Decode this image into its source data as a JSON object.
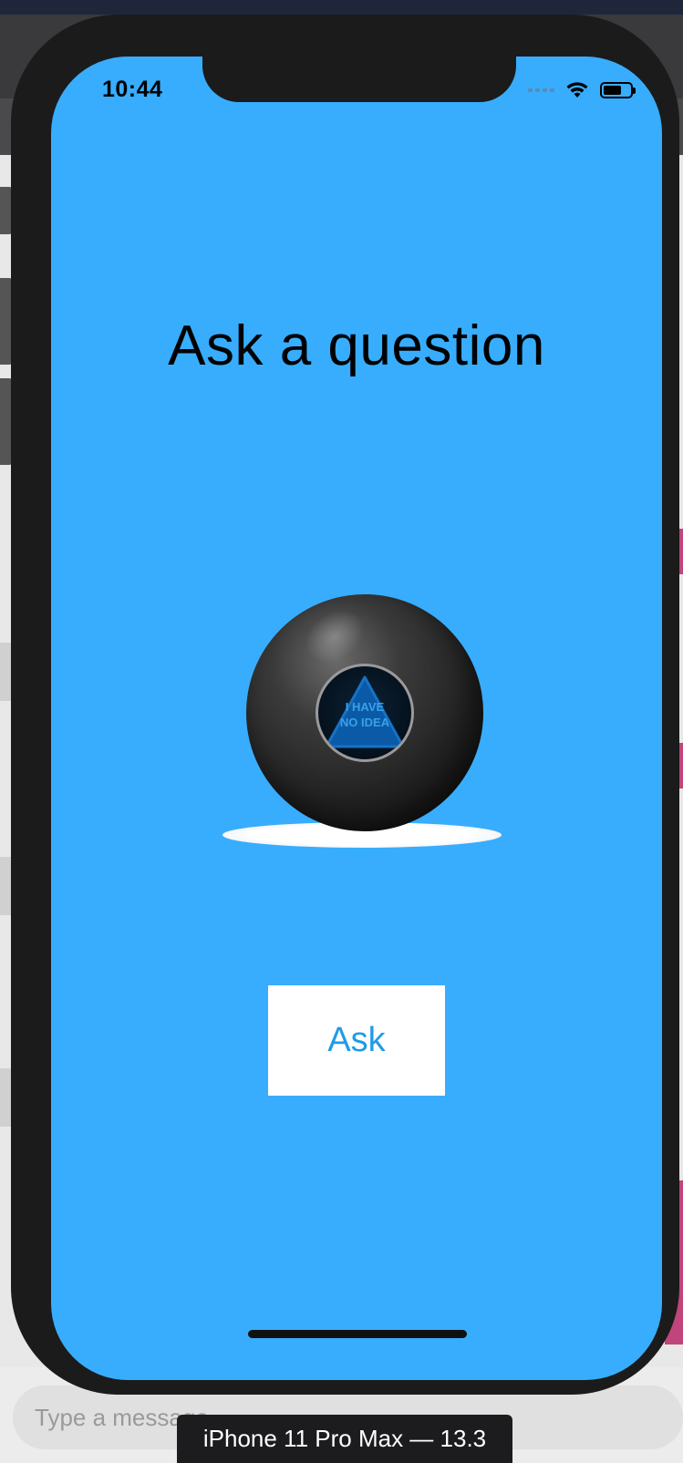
{
  "status_bar": {
    "time": "10:44"
  },
  "app": {
    "title": "Ask a question",
    "answer_line1": "I HAVE",
    "answer_line2": "NO IDEA",
    "ask_button_label": "Ask",
    "background_color": "#38adfd",
    "button_text_color": "#1f9be8"
  },
  "host": {
    "message_placeholder": "Type a message",
    "simulator_label": "iPhone 11 Pro Max — 13.3"
  }
}
